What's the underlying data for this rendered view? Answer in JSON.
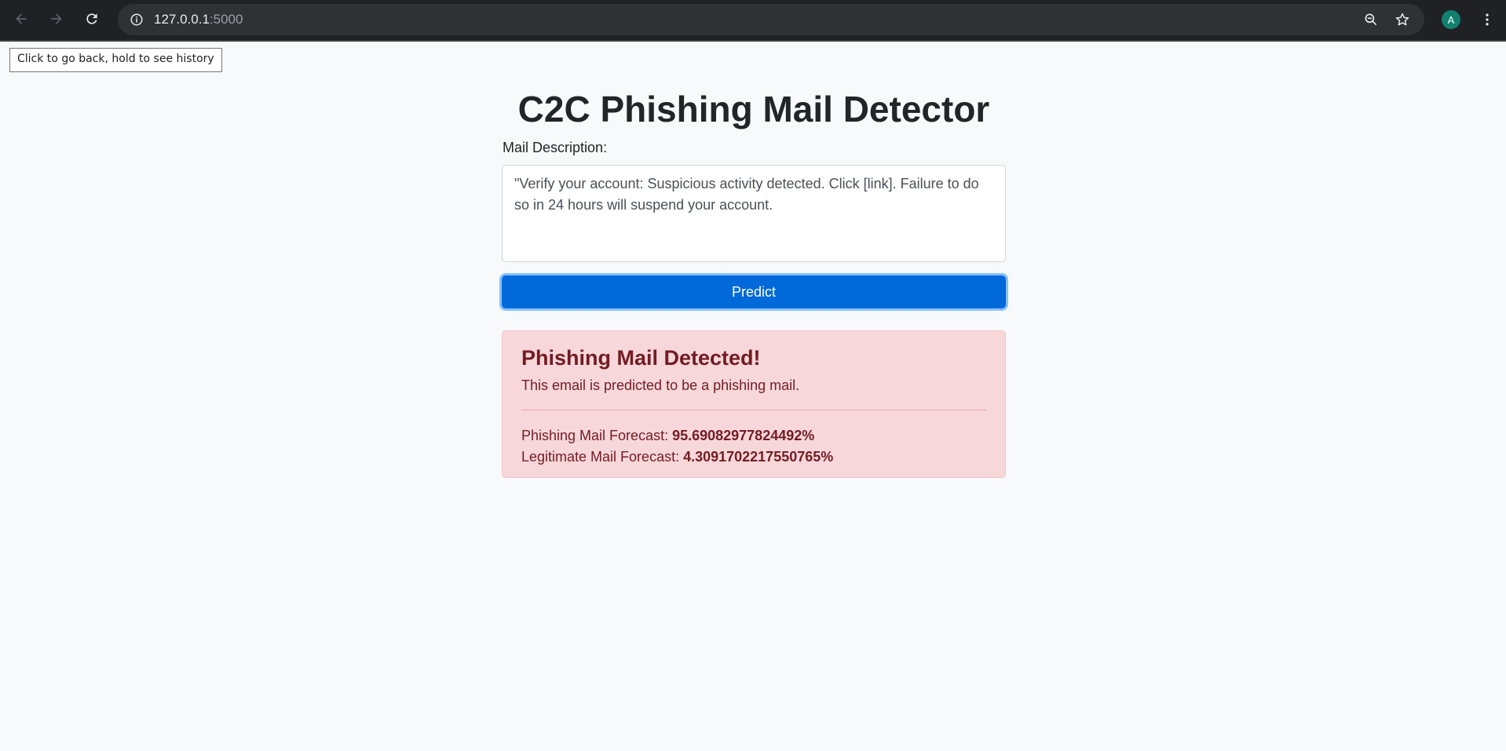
{
  "browser": {
    "url_host": "127.0.0.1",
    "url_port": ":5000",
    "avatar_letter": "A",
    "back_tooltip": "Click to go back, hold to see history"
  },
  "page": {
    "title": "C2C Phishing Mail Detector",
    "mail_label": "Mail Description:",
    "mail_value": "\"Verify your account: Suspicious activity detected. Click [link]. Failure to do so in 24 hours will suspend your account.",
    "predict_label": "Predict"
  },
  "result": {
    "heading": "Phishing Mail Detected!",
    "message": "This email is predicted to be a phishing mail.",
    "phishing_label": "Phishing Mail Forecast: ",
    "phishing_value": "95.69082977824492%",
    "legit_label": "Legitimate Mail Forecast: ",
    "legit_value": "4.3091702217550765%"
  },
  "colors": {
    "accent": "#0069d9",
    "alert_bg": "#f8d7da",
    "alert_text": "#721c24",
    "avatar": "#12806f"
  }
}
